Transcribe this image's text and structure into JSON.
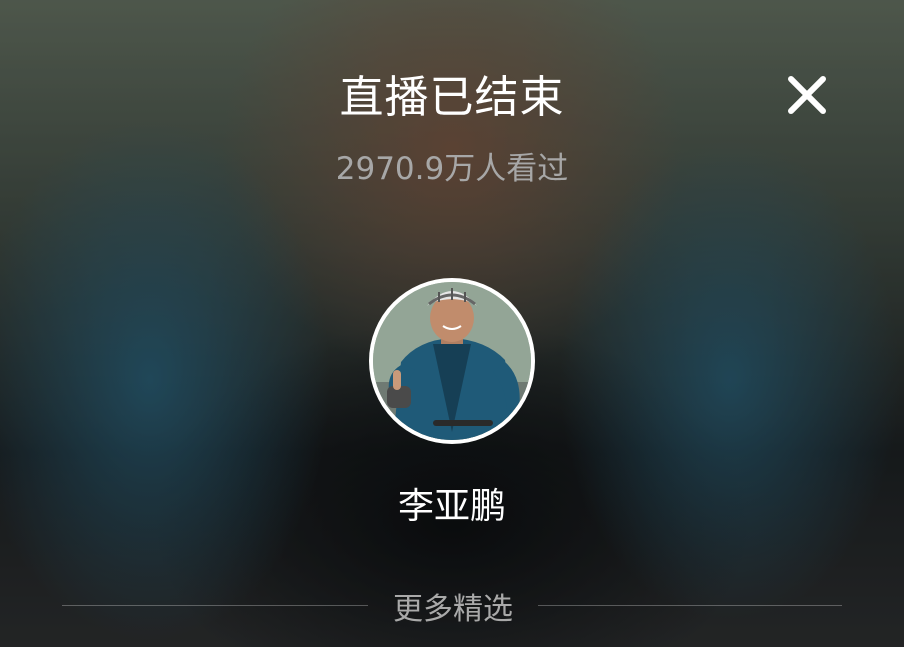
{
  "header": {
    "title": "直播已结束",
    "viewers": "2970.9万人看过",
    "close_icon": "close-icon"
  },
  "host": {
    "avatar_icon": "cyclist-avatar",
    "name": "李亚鹏"
  },
  "more": {
    "label": "更多精选"
  },
  "colors": {
    "title": "#ffffff",
    "subtext": "#a7a7a7",
    "divider": "#5a5a5a"
  }
}
